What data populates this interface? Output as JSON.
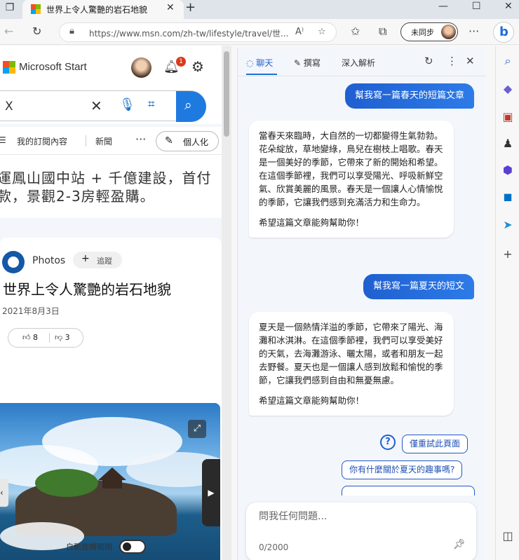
{
  "tab": {
    "title": "世界上令人驚艷的岩石地貌",
    "close": "✕",
    "new_tab": "+",
    "favicon_colors": [
      "#f25022",
      "#7fba00",
      "#00a4ef",
      "#ffb900"
    ]
  },
  "window": {
    "minimize": "—",
    "maximize": "☐",
    "close": "✕",
    "tab_actions": "❐"
  },
  "toolbar": {
    "back": "←",
    "refresh": "↻",
    "url": "https://www.msn.com/zh-tw/lifestyle/travel/世...",
    "read_aloud": "A⁾",
    "sync_label": "未同步",
    "more": "···",
    "bing": "b"
  },
  "page": {
    "brand": "Microsoft Start",
    "notification_count": "1",
    "search_left": "X",
    "nav_items": [
      "我的訂閱內容",
      "新聞"
    ],
    "nav_more": "···",
    "personalize_label": "個人化",
    "promo_text": "運鳳山國中站 + 千億建設，首付款，景觀2-3房輕盈購。",
    "source_name": "Photos",
    "follow_label": "追蹤",
    "article_title": "世界上令人驚艷的岩石地貌",
    "article_date": "2021年8月3日",
    "likes": "8",
    "dislikes": "3",
    "autoplay_label": "自動旋轉關閉"
  },
  "chat": {
    "tabs": [
      "聊天",
      "撰寫",
      "深入解析"
    ],
    "messages": [
      {
        "role": "user",
        "text": "幫我寫一篇春天的短篇文章"
      },
      {
        "role": "bot",
        "paragraphs": [
          "當春天來臨時，大自然的一切都變得生氣勃勃。花朵綻放，草地變綠，鳥兒在樹枝上唱歌。春天是一個美好的季節，它帶來了新的開始和希望。在這個季節裡，我們可以享受陽光、呼吸新鮮空氣、欣賞美麗的風景。春天是一個讓人心情愉悅的季節，它讓我們感到充滿活力和生命力。",
          "希望這篇文章能夠幫助你！"
        ]
      },
      {
        "role": "user",
        "text": "幫我寫一篇夏天的短文"
      },
      {
        "role": "bot",
        "paragraphs": [
          "夏天是一個熱情洋溢的季節，它帶來了陽光、海灘和冰淇淋。在這個季節裡，我們可以享受美好的天氣，去海灘游泳、曬太陽，或者和朋友一起去野餐。夏天也是一個讓人感到放鬆和愉悅的季節，它讓我們感到自由和無憂無慮。",
          "希望這篇文章能夠幫助你！"
        ]
      }
    ],
    "help_icon": "?",
    "suggestions": [
      "僅重試此頁面",
      "你有什麼關於夏天的趣事嗎?"
    ],
    "input_placeholder": "問我任何問題...",
    "char_count": "0/2000"
  },
  "colors": {
    "accent": "#1f6fd6",
    "user_bubble": "#2563d8"
  }
}
